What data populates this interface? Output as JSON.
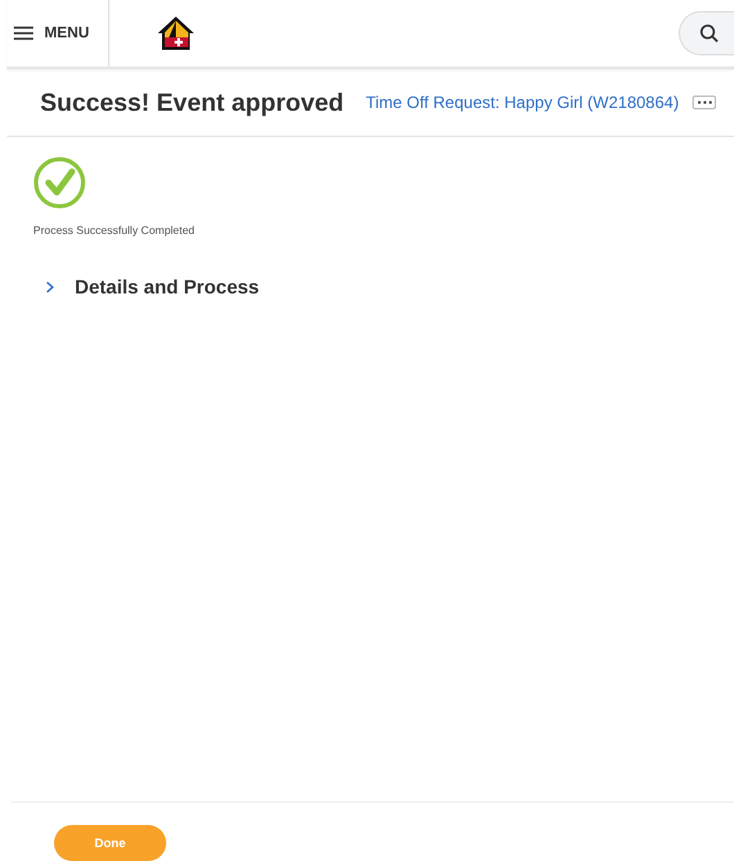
{
  "header": {
    "menu_label": "MENU"
  },
  "title": "Success! Event approved",
  "subtitle_link": "Time Off Request: Happy Girl (W2180864)",
  "status": {
    "text": "Process Successfully Completed"
  },
  "section": {
    "label": "Details and Process",
    "expanded": false
  },
  "buttons": [
    {
      "label": "Done"
    }
  ]
}
